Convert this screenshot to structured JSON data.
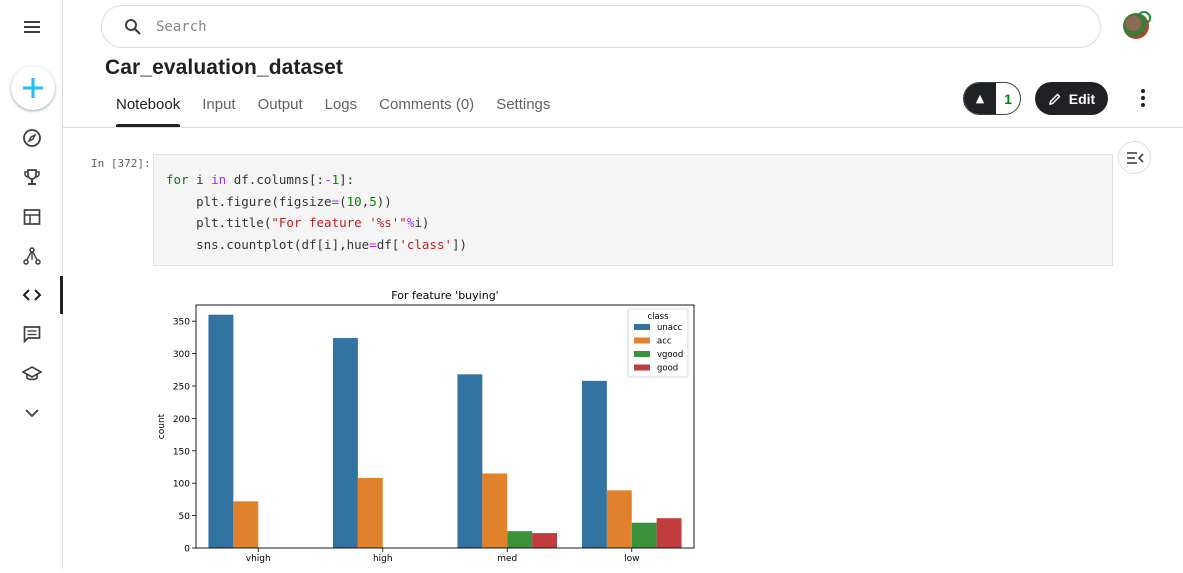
{
  "search": {
    "placeholder": "Search"
  },
  "notebook": {
    "title": "Car_evaluation_dataset"
  },
  "tabs": [
    {
      "label": "Notebook",
      "active": true
    },
    {
      "label": "Input"
    },
    {
      "label": "Output"
    },
    {
      "label": "Logs"
    },
    {
      "label": "Comments (0)"
    },
    {
      "label": "Settings"
    }
  ],
  "actions": {
    "vote_count": "1",
    "edit_label": "Edit"
  },
  "cell": {
    "prompt": "In [372]:",
    "code_lines": [
      "for i in df.columns[:-1]:",
      "    plt.figure(figsize=(10,5))",
      "    plt.title(\"For feature '%s'\"%i)",
      "    sns.countplot(df[i],hue=df['class'])"
    ]
  },
  "sidebar": {
    "icons": [
      "menu-icon",
      "plus-icon",
      "compass-icon",
      "trophy-icon",
      "table-icon",
      "models-icon",
      "code-icon",
      "discussion-icon",
      "learn-icon",
      "chevron-down-icon"
    ]
  },
  "colors": {
    "unacc": "#3274a1",
    "acc": "#e1812c",
    "vgood": "#3a923a",
    "good": "#c03d3e",
    "accent_plus": "#20beff"
  },
  "chart_data": {
    "type": "bar",
    "title": "For feature 'buying'",
    "xlabel": "",
    "ylabel": "count",
    "categories": [
      "vhigh",
      "high",
      "med",
      "low"
    ],
    "ylim": [
      0,
      375
    ],
    "yticks": [
      0,
      50,
      100,
      150,
      200,
      250,
      300,
      350
    ],
    "legend": {
      "title": "class",
      "placement": "top-right"
    },
    "series": [
      {
        "name": "unacc",
        "values": [
          360,
          324,
          268,
          258
        ]
      },
      {
        "name": "acc",
        "values": [
          72,
          108,
          115,
          89
        ]
      },
      {
        "name": "vgood",
        "values": [
          0,
          0,
          26,
          39
        ]
      },
      {
        "name": "good",
        "values": [
          0,
          0,
          23,
          46
        ]
      }
    ]
  }
}
